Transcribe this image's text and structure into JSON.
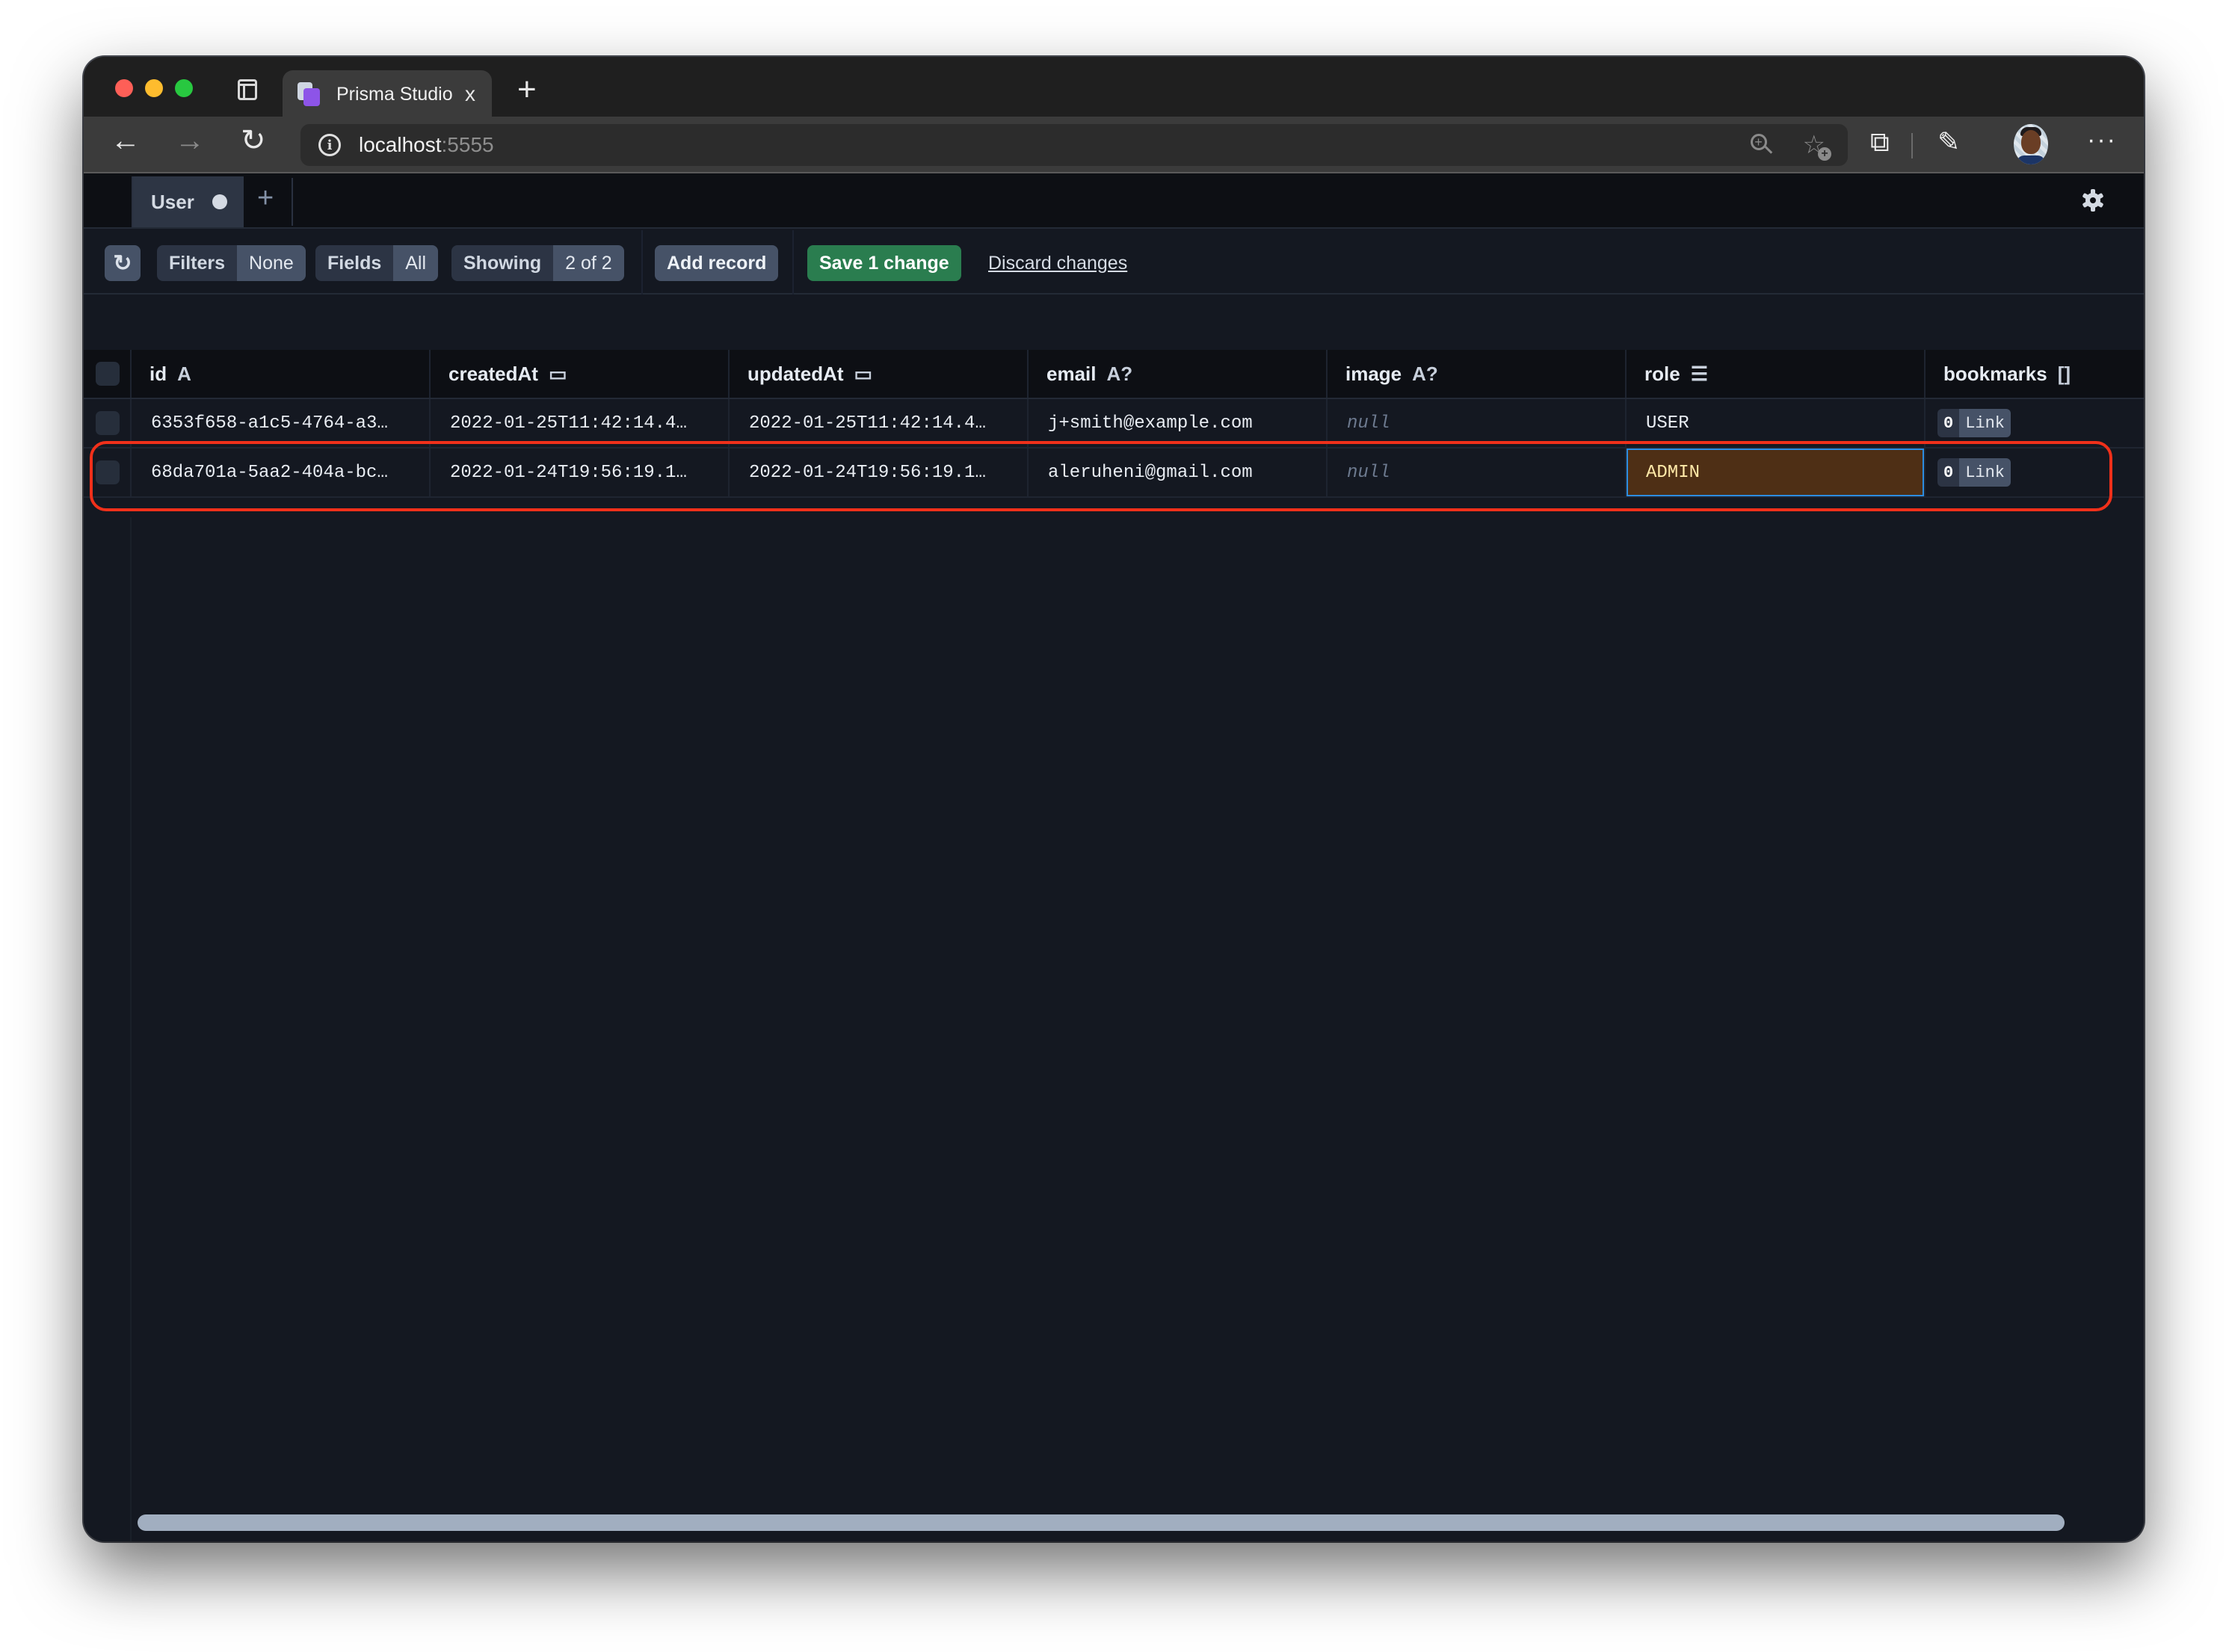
{
  "browser": {
    "tab_title": "Prisma Studio",
    "tab_close": "x",
    "new_tab": "+",
    "url_host": "localhost",
    "url_port": ":5555",
    "nav": {
      "back": "←",
      "forward": "→",
      "reload": "↻"
    },
    "icons": {
      "sidebar": "sidebar-toggle-icon",
      "info": "i",
      "zoom": "+",
      "favorite": "☆",
      "favorite_plus": "+",
      "extensions": "⧉",
      "capture": "✎",
      "more": "···"
    }
  },
  "app": {
    "tabs": [
      {
        "label": "User",
        "unsaved": true
      }
    ],
    "add_tab": "+",
    "toolbar": {
      "refresh_icon": "↻",
      "filters": {
        "label": "Filters",
        "value": "None"
      },
      "fields": {
        "label": "Fields",
        "value": "All"
      },
      "showing": {
        "label": "Showing",
        "value": "2 of 2"
      },
      "add_record": "Add record",
      "save": "Save 1 change",
      "discard": "Discard changes"
    },
    "table": {
      "columns": [
        {
          "name": "id",
          "type": "A"
        },
        {
          "name": "createdAt",
          "type": "▭"
        },
        {
          "name": "updatedAt",
          "type": "▭"
        },
        {
          "name": "email",
          "type": "A?"
        },
        {
          "name": "image",
          "type": "A?"
        },
        {
          "name": "role",
          "type": "☰"
        },
        {
          "name": "bookmarks",
          "type": "[]"
        }
      ],
      "rows": [
        {
          "id": "6353f658-a1c5-4764-a3…",
          "createdAt": "2022-01-25T11:42:14.4…",
          "updatedAt": "2022-01-25T11:42:14.4…",
          "email": "j+smith@example.com",
          "image": "null",
          "role": "USER",
          "bookmarks_count": "0",
          "bookmarks_link": "Link",
          "role_edited": false
        },
        {
          "id": "68da701a-5aa2-404a-bc…",
          "createdAt": "2022-01-24T19:56:19.1…",
          "updatedAt": "2022-01-24T19:56:19.1…",
          "email": "aleruheni@gmail.com",
          "image": "null",
          "role": "ADMIN",
          "bookmarks_count": "0",
          "bookmarks_link": "Link",
          "role_edited": true
        }
      ]
    }
  },
  "colors": {
    "save_green": "#2a7d4f",
    "edited_cell_bg": "#4e2f15",
    "edited_cell_border": "#2d8de0",
    "highlight_red": "#f0301a",
    "app_bg": "#141821"
  }
}
